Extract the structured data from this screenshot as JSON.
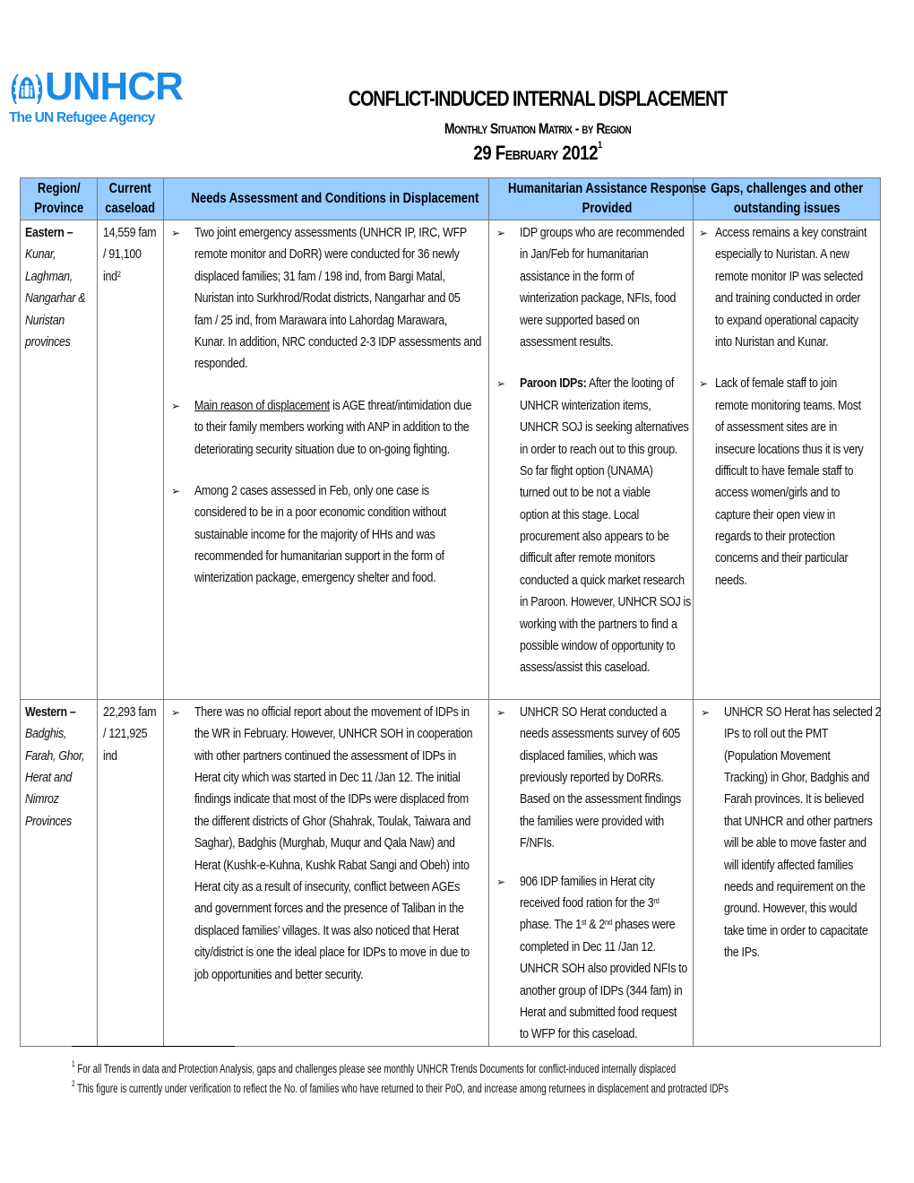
{
  "logo": {
    "icon": "unhcr-emblem-icon",
    "wordmark": "UNHCR",
    "tagline": "The UN Refugee Agency",
    "color": "#1a8ce8"
  },
  "title": {
    "main": "CONFLICT-INDUCED INTERNAL DISPLACEMENT",
    "sub": "Monthly Situation Matrix - by Region",
    "date": "29 February 2012",
    "date_footnote": "1"
  },
  "table": {
    "header_color": "#99ccff",
    "headers": {
      "region": [
        "Region/",
        "Province"
      ],
      "caseload": [
        "Current",
        "caseload"
      ],
      "needs": "Needs Assessment and Conditions in Displacement",
      "response": [
        "Humanitarian Assistance Response",
        "Provided"
      ],
      "gaps": [
        "Gaps, challenges and  other",
        "outstanding  issues"
      ]
    },
    "bullet_icon": "arrow-bullet-icon",
    "rows": [
      {
        "region": "Eastern –",
        "provinces": [
          "Kunar,",
          "Laghman,",
          "Nangarhar &",
          "Nuristan",
          "provinces"
        ],
        "caseload": [
          "14,559 fam",
          "/ 91,100",
          "ind"
        ],
        "caseload_footnote": "2",
        "needs": [
          {
            "lines": [
              "Two joint emergency assessments (UNHCR IP, IRC, WFP",
              "remote monitor and DoRR) were conducted for 36 newly",
              "displaced families; 31 fam / 198 ind, from Bargi Matal,",
              "Nuristan into Surkhrod/Rodat districts, Nangarhar and 05",
              "fam / 25 ind, from Marawara into Lahordag Marawara,",
              "Kunar. In addition, NRC conducted 2-3 IDP assessments and",
              "responded."
            ]
          },
          {
            "underlined_lead": "Main reason of displacement",
            "lines": [
              " is AGE threat/intimidation due",
              "to their family members working with ANP in addition to the",
              "deteriorating security situation due to on-going fighting."
            ]
          },
          {
            "lines": [
              "Among 2 cases assessed in Feb, only one case is",
              "considered to be in a poor economic condition without",
              "sustainable income for the majority of HHs and was",
              "recommended for humanitarian support in the form of",
              "winterization package, emergency shelter and food."
            ]
          }
        ],
        "response": [
          {
            "lines": [
              "IDP groups who are recommended",
              "in Jan/Feb for humanitarian",
              "assistance in the form of",
              "winterization package, NFIs, food",
              "were supported based on",
              "assessment results."
            ]
          },
          {
            "bold_lead": "Paroon IDPs:",
            "lines": [
              " After the looting of",
              "UNHCR winterization items,",
              "UNHCR SOJ is seeking alternatives",
              "in order to reach out to this group.",
              "So far flight option (UNAMA)",
              "turned out to be not a viable",
              "option at this stage. Local",
              "procurement also appears to be",
              "difficult after remote monitors",
              "conducted a quick market research",
              "in Paroon. However, UNHCR SOJ is",
              "working with the partners to find a",
              "possible window of opportunity to",
              "assess/assist this caseload."
            ]
          }
        ],
        "gaps": [
          {
            "lines": [
              "Access remains a key constraint",
              "especially to Nuristan. A new",
              "remote monitor IP was selected",
              "and training conducted in order",
              "to expand operational capacity",
              "into Nuristan and Kunar."
            ]
          },
          {
            "lines": [
              "Lack of female staff to join",
              "remote monitoring teams. Most",
              "of assessment sites are in",
              "insecure locations thus it is very",
              "difficult to have female staff to",
              "access women/girls and to",
              "capture their open view in",
              "regards to their protection",
              "concerns and their particular",
              "needs."
            ]
          }
        ]
      },
      {
        "region": "Western –",
        "provinces": [
          "Badghis,",
          "Farah, Ghor,",
          "Herat and",
          "Nimroz",
          "Provinces"
        ],
        "caseload": [
          "22,293 fam",
          "/ 121,925",
          "ind"
        ],
        "needs": [
          {
            "lines": [
              "There was no official report about the movement of IDPs in",
              "the WR in February. However, UNHCR SOH in cooperation",
              "with other partners continued the assessment of IDPs in",
              "Herat city which was started in Dec 11 /Jan 12. The initial",
              "findings indicate that most of the IDPs were displaced from",
              "the different districts of Ghor (Shahrak, Toulak, Taiwara and",
              "Saghar), Badghis (Murghab, Muqur and Qala Naw) and",
              "Herat (Kushk-e-Kuhna, Kushk Rabat Sangi and Obeh) into",
              "Herat city as a result of insecurity, conflict between AGEs",
              "and government forces and the presence of Taliban in the",
              "displaced families’ villages. It was also noticed that Herat",
              "city/district is one the ideal place for IDPs to move in due to",
              "job opportunities and better security."
            ]
          }
        ],
        "response": [
          {
            "lines": [
              "UNHCR SO Herat conducted a",
              "needs assessments survey of 605",
              "displaced families, which was",
              "previously reported by DoRRs.",
              "Based on the assessment findings",
              "the families were provided with",
              "F/NFIs."
            ]
          },
          {
            "line1": "906 IDP families in Herat city",
            "line2_pre": "received food ration for the 3",
            "line2_sup": "rd",
            "line3_a": "phase. The 1",
            "line3_sup1": "st",
            "line3_b": " & 2",
            "line3_sup2": "nd",
            "line3_c": " phases were",
            "lines": [
              "completed in Dec 11 /Jan 12.",
              "UNHCR SOH also provided NFIs to",
              "another group of IDPs (344 fam) in",
              "Herat and submitted food request",
              "to WFP for this caseload."
            ]
          }
        ],
        "gaps": [
          {
            "lines": [
              "UNHCR SO Herat has selected 2",
              "IPs to roll out the PMT",
              "(Population Movement",
              "Tracking) in Ghor, Badghis and",
              "Farah provinces. It is believed",
              "that UNHCR and other partners",
              "will be able to move faster and",
              "will identify affected families",
              "needs and requirement on the",
              "ground.  However, this would",
              "take time in order to capacitate",
              "the IPs."
            ]
          }
        ]
      }
    ]
  },
  "footnotes": [
    {
      "num": "1",
      "text": "For all Trends in data and Protection Analysis, gaps and challenges please see monthly UNHCR Trends Documents for conflict-induced internally displaced"
    },
    {
      "num": "2",
      "text": "This figure is currently under verification to reflect the No. of families who have returned to their PoO, and increase among returnees in displacement and protracted IDPs"
    }
  ]
}
